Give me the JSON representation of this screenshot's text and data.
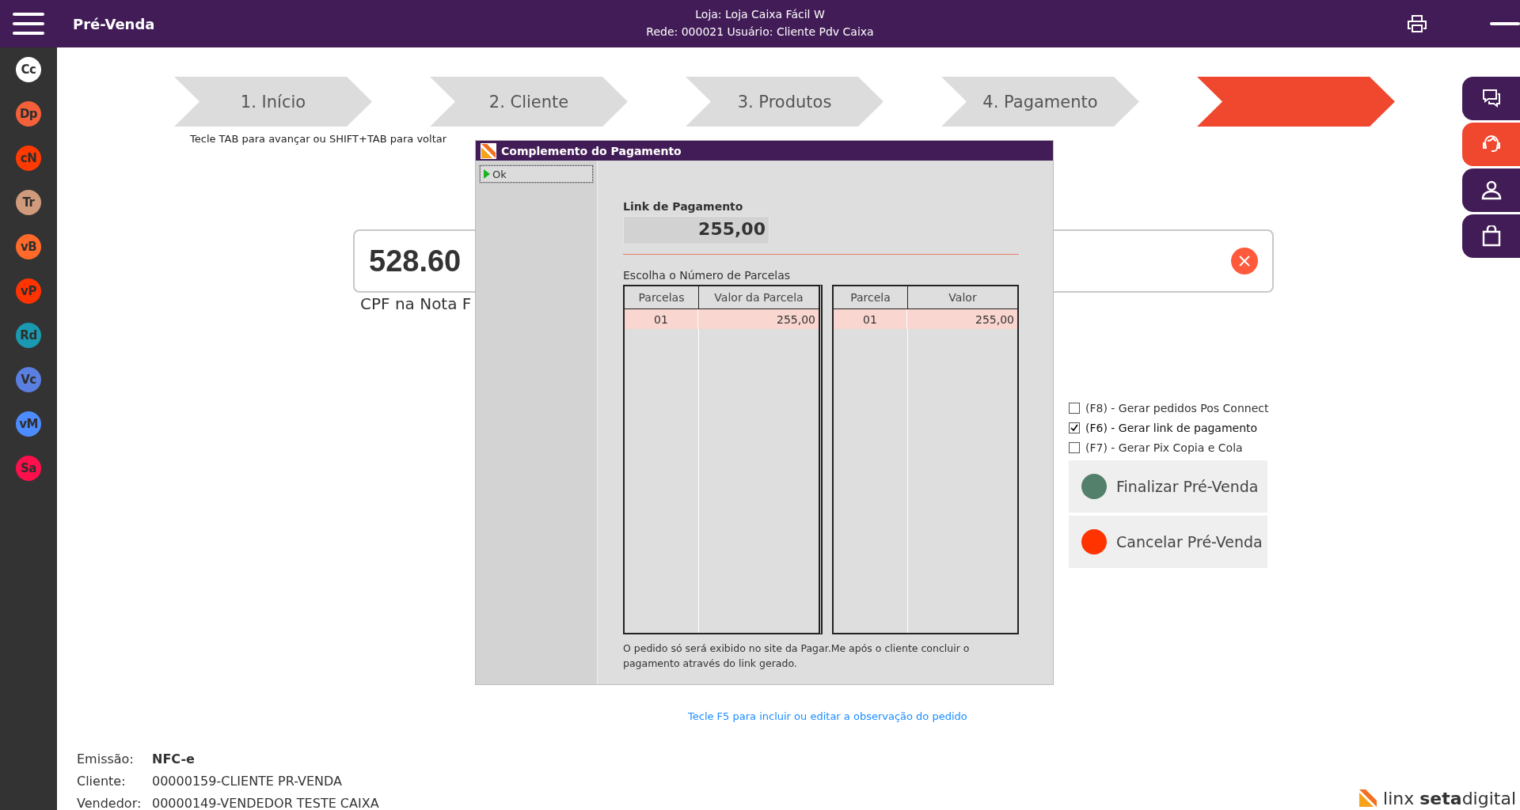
{
  "header": {
    "title": "Pré-Venda",
    "store_line": "Loja: Loja Caixa Fácil W",
    "network_line": "Rede: 000021 Usuário: Cliente Pdv Caixa"
  },
  "sidebar": {
    "items": [
      {
        "label": "Cc",
        "color": "#ffffff"
      },
      {
        "label": "Dp",
        "color": "#f4603a"
      },
      {
        "label": "cN",
        "color": "#ff3a00"
      },
      {
        "label": "Tr",
        "color": "#d09a7c"
      },
      {
        "label": "vB",
        "color": "#ff6a2a"
      },
      {
        "label": "vP",
        "color": "#ff3300"
      },
      {
        "label": "Rd",
        "color": "#1a9ab0"
      },
      {
        "label": "Vc",
        "color": "#5a7fe0"
      },
      {
        "label": "vM",
        "color": "#4d8cff"
      },
      {
        "label": "Sa",
        "color": "#ff0f4b"
      }
    ]
  },
  "steps": [
    {
      "label": "1. Início",
      "selected": false
    },
    {
      "label": "2. Cliente",
      "selected": false
    },
    {
      "label": "3. Produtos",
      "selected": false
    },
    {
      "label": "4. Pagamento",
      "selected": false
    },
    {
      "selected": true
    }
  ],
  "hint": "Tecle TAB para avançar ou SHIFT+TAB para voltar",
  "amount_field": {
    "value": "528.60"
  },
  "cpf_label": "CPF na Nota F",
  "options": [
    {
      "label": "(F8) - Gerar pedidos Pos Connect",
      "checked": false
    },
    {
      "label": "(F6) - Gerar link de pagamento",
      "checked": true
    },
    {
      "label": "(F7) - Gerar Pix Copia e Cola",
      "checked": false
    }
  ],
  "actions": [
    {
      "label": "Finalizar Pré-Venda",
      "color": "#53806a"
    },
    {
      "label": "Cancelar Pré-Venda",
      "color": "#ff3300"
    }
  ],
  "observation_link": "Tecle F5 para incluir ou editar a observação do pedido",
  "footer": {
    "rows": [
      {
        "label": "Emissão:",
        "value": "NFC-e",
        "emphasis": true
      },
      {
        "label": "Cliente:",
        "value": "00000159-CLIENTE PR-VENDA",
        "emphasis": false
      },
      {
        "label": "Vendedor:",
        "value": "00000149-VENDEDOR TESTE CAIXA",
        "emphasis": false
      }
    ]
  },
  "brand": {
    "text": "linx **seta**digital"
  },
  "right_tabs": [
    {
      "kind": "chat",
      "selected": false
    },
    {
      "kind": "support",
      "selected": true
    },
    {
      "kind": "user",
      "selected": false
    },
    {
      "kind": "bag",
      "selected": false
    }
  ],
  "dialog": {
    "title": "Complemento do Pagamento",
    "ok_button": "Ok",
    "link_label": "Link de Pagamento",
    "link_value": "255,00",
    "installments_label": "Escolha o Número de Parcelas",
    "installments_table": {
      "columns": [
        "Parcelas",
        "Valor da Parcela"
      ],
      "rows": [
        {
          "cells": [
            "01",
            "255,00"
          ],
          "selected": true
        }
      ]
    },
    "schedule_table": {
      "columns": [
        "Parcela",
        "Valor"
      ],
      "rows": [
        {
          "cells": [
            "01",
            "255,00"
          ],
          "selected": true
        }
      ]
    },
    "note": "O pedido só será exibido no site da Pagar.Me após o cliente concluir o pagamento através do link gerado."
  }
}
